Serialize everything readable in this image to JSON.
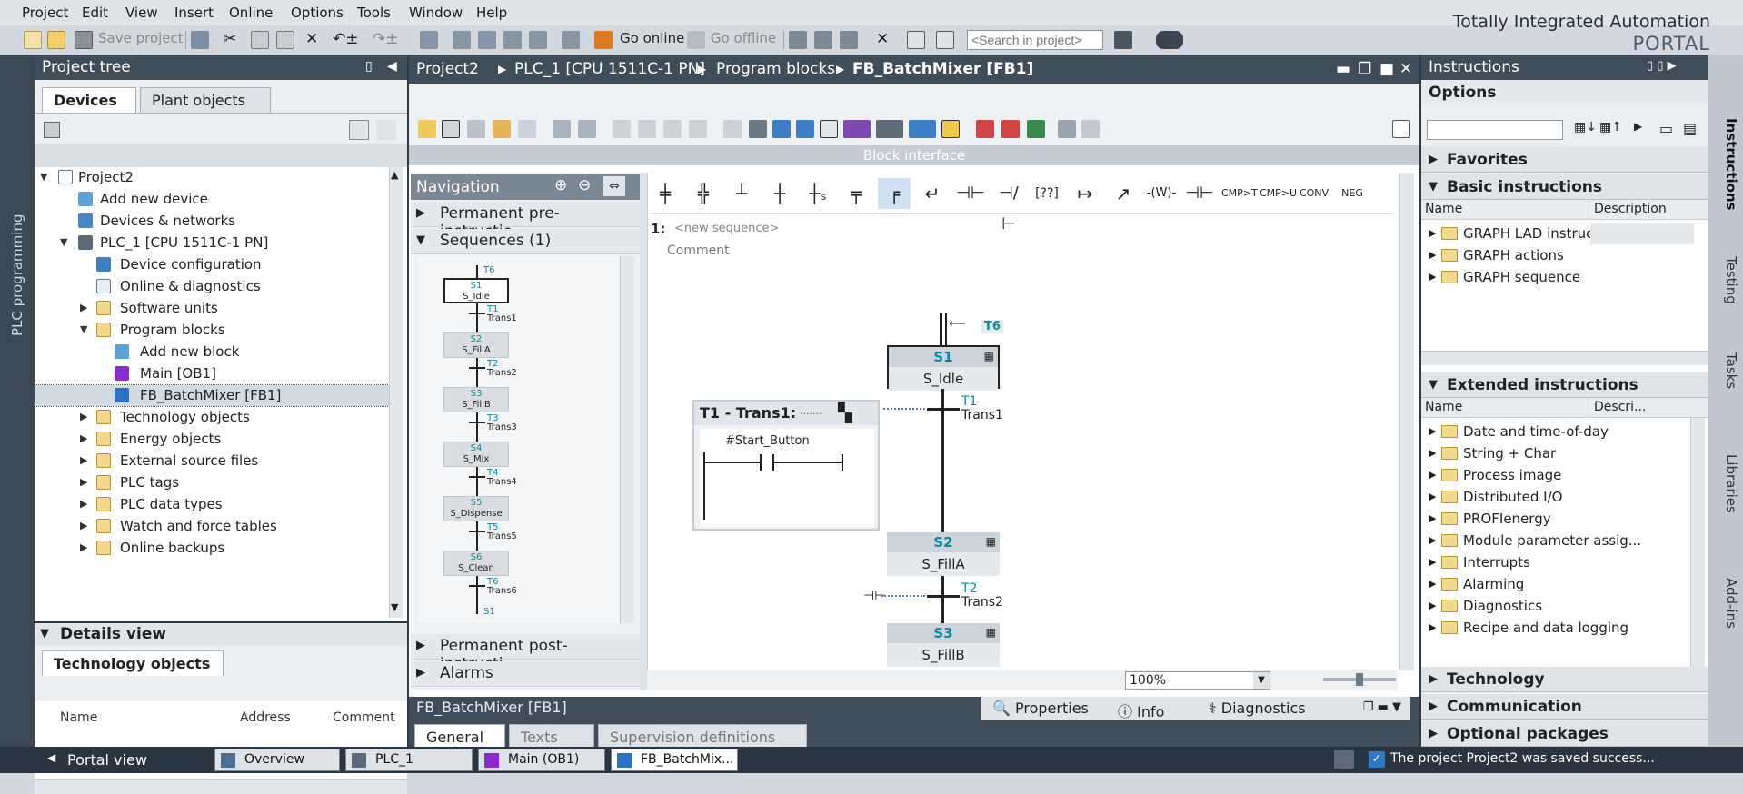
{
  "menu": [
    "Project",
    "Edit",
    "View",
    "Insert",
    "Online",
    "Options",
    "Tools",
    "Window",
    "Help"
  ],
  "brand": {
    "line1": "Totally Integrated Automation",
    "line2": "PORTAL"
  },
  "toolbar": {
    "save_label": "Save project",
    "go_online": "Go online",
    "go_offline": "Go offline",
    "search_placeholder": "<Search in project>"
  },
  "left_strip_label": "PLC programming",
  "project_tree": {
    "title": "Project tree",
    "tabs": [
      "Devices",
      "Plant objects"
    ],
    "items": [
      {
        "label": "Project2"
      },
      {
        "label": "Add new device"
      },
      {
        "label": "Devices & networks"
      },
      {
        "label": "PLC_1 [CPU 1511C-1 PN]"
      },
      {
        "label": "Device configuration"
      },
      {
        "label": "Online & diagnostics"
      },
      {
        "label": "Software units"
      },
      {
        "label": "Program blocks"
      },
      {
        "label": "Add new block"
      },
      {
        "label": "Main [OB1]"
      },
      {
        "label": "FB_BatchMixer [FB1]"
      },
      {
        "label": "Technology objects"
      },
      {
        "label": "Energy objects"
      },
      {
        "label": "External source files"
      },
      {
        "label": "PLC tags"
      },
      {
        "label": "PLC data types"
      },
      {
        "label": "Watch and force tables"
      },
      {
        "label": "Online backups"
      }
    ],
    "details_title": "Details view",
    "details_tab": "Technology objects",
    "details_cols": [
      "Name",
      "Address",
      "Comment"
    ]
  },
  "breadcrumb": [
    "Project2",
    "PLC_1 [CPU 1511C-1 PN]",
    "Program blocks",
    "FB_BatchMixer [FB1]"
  ],
  "block_interface": "Block interface",
  "navigation": {
    "title": "Navigation",
    "sections": [
      "Permanent pre-instructio...",
      "Sequences (1)",
      "Permanent post-instructi...",
      "Alarms"
    ],
    "mini_steps": [
      {
        "s": "S1",
        "name": "S_Idle",
        "t": "T1",
        "tn": "Trans1"
      },
      {
        "s": "S2",
        "name": "S_FillA",
        "t": "T2",
        "tn": "Trans2"
      },
      {
        "s": "S3",
        "name": "S_FillB",
        "t": "T3",
        "tn": "Trans3"
      },
      {
        "s": "S4",
        "name": "S_Mix",
        "t": "T4",
        "tn": "Trans4"
      },
      {
        "s": "S5",
        "name": "S_Dispense",
        "t": "T5",
        "tn": "Trans5"
      },
      {
        "s": "S6",
        "name": "S_Clean",
        "t": "T6",
        "tn": "Trans6"
      }
    ],
    "jump_top": "T6",
    "jump_bottom": "S1"
  },
  "instruction_bar": [
    "CMP>T",
    "CMP>U",
    "CONV",
    "NEG"
  ],
  "sequence": {
    "number": "1:",
    "name_placeholder": "<new sequence>",
    "comment": "Comment",
    "jump_label": "T6",
    "steps": [
      {
        "id": "S1",
        "name": "S_Idle"
      },
      {
        "id": "S2",
        "name": "S_FillA"
      },
      {
        "id": "S3",
        "name": "S_FillB"
      }
    ],
    "transitions": [
      {
        "id": "T1",
        "name": "Trans1"
      },
      {
        "id": "T2",
        "name": "Trans2"
      }
    ],
    "transition_box": {
      "title": "T1 - Trans1:",
      "dots": ".......",
      "contact": "#Start_Button"
    },
    "zoom": "100%"
  },
  "inspector": {
    "title": "FB_BatchMixer [FB1]",
    "tabs": [
      "Properties",
      "Info",
      "Diagnostics"
    ],
    "subtabs": [
      "General",
      "Texts",
      "Supervision definitions"
    ]
  },
  "instructions_panel": {
    "title": "Instructions",
    "options": "Options",
    "favorites": "Favorites",
    "basic": "Basic instructions",
    "col_name": "Name",
    "col_desc": "Description",
    "basic_items": [
      "GRAPH LAD instructions",
      "GRAPH actions",
      "GRAPH sequence"
    ],
    "extended": "Extended instructions",
    "col_desc_short": "Descri...",
    "extended_items": [
      "Date and time-of-day",
      "String + Char",
      "Process image",
      "Distributed I/O",
      "PROFIenergy",
      "Module parameter assig...",
      "Interrupts",
      "Alarming",
      "Diagnostics",
      "Recipe and data logging"
    ],
    "technology": "Technology",
    "communication": "Communication",
    "optional": "Optional packages"
  },
  "side_tabs": [
    "Instructions",
    "Testing",
    "Tasks",
    "Libraries",
    "Add-ins"
  ],
  "taskbar": {
    "portal": "Portal view",
    "items": [
      "Overview",
      "PLC_1",
      "Main (OB1)",
      "FB_BatchMix..."
    ],
    "status": "The project Project2 was saved success..."
  }
}
